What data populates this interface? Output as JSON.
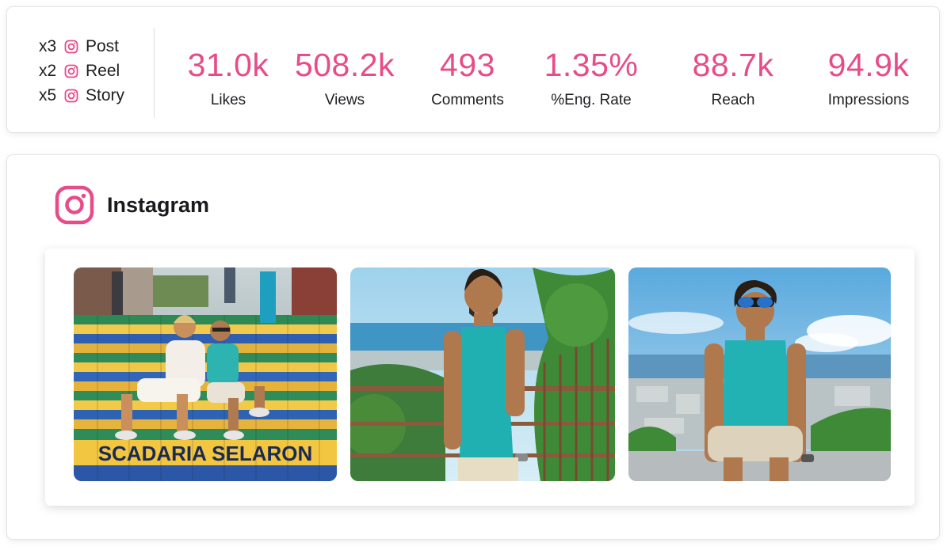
{
  "content_types": [
    {
      "count": "x3",
      "icon": "instagram-icon",
      "label": "Post"
    },
    {
      "count": "x2",
      "icon": "instagram-icon",
      "label": "Reel"
    },
    {
      "count": "x5",
      "icon": "instagram-icon",
      "label": "Story"
    }
  ],
  "metrics": [
    {
      "value": "31.0k",
      "label": "Likes"
    },
    {
      "value": "508.2k",
      "label": "Views"
    },
    {
      "value": "493",
      "label": "Comments"
    },
    {
      "value": "1.35%",
      "label": "%Eng. Rate"
    },
    {
      "value": "88.7k",
      "label": "Reach"
    },
    {
      "value": "94.9k",
      "label": "Impressions"
    }
  ],
  "platform": {
    "name": "Instagram",
    "icon": "instagram-icon"
  },
  "media": [
    {
      "name": "post-image-stairs",
      "banner_text": "SCADARIA SELARON"
    },
    {
      "name": "post-image-railing"
    },
    {
      "name": "post-image-seated"
    }
  ],
  "colors": {
    "accent": "#e84c88",
    "text": "#1f1f23",
    "border": "#e4e4e8"
  }
}
